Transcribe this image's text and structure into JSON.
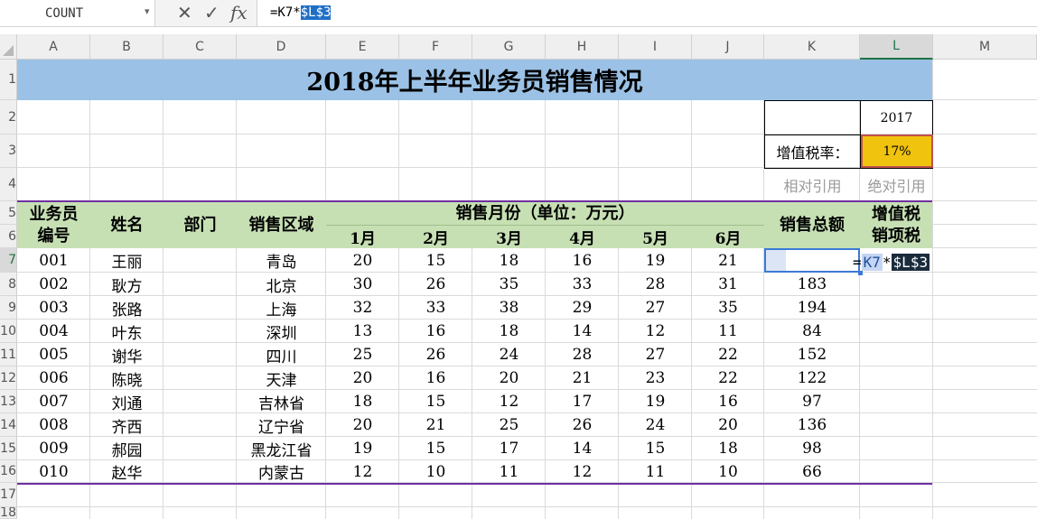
{
  "formula_bar": {
    "name_box": "COUNT",
    "icons": [
      "cancel-icon",
      "enter-icon",
      "function-icon"
    ],
    "cancel_glyph": "✕",
    "enter_glyph": "✓",
    "fx_label": "fx",
    "formula_prefix": "=K7*",
    "formula_abs_ref": "$L$3"
  },
  "columns": [
    "A",
    "B",
    "C",
    "D",
    "E",
    "F",
    "G",
    "H",
    "I",
    "J",
    "K",
    "L",
    "M"
  ],
  "rows": [
    "1",
    "2",
    "3",
    "4",
    "5",
    "6",
    "7",
    "8",
    "9",
    "10",
    "11",
    "12",
    "13",
    "14",
    "15",
    "16",
    "17",
    "18"
  ],
  "title": "2018年上半年业务员销售情况",
  "year_cell": "2017",
  "tax_label": "增值税率：",
  "tax_rate": "17%",
  "relative_ref_label": "相对引用",
  "absolute_ref_label": "绝对引用",
  "headers": {
    "id_line1": "业务员",
    "id_line2": "编号",
    "name": "姓名",
    "dept": "部门",
    "region": "销售区域",
    "months_group": "销售月份（单位：万元）",
    "months": [
      "1月",
      "2月",
      "3月",
      "4月",
      "5月",
      "6月"
    ],
    "total": "销售总额",
    "vat_line1": "增值税",
    "vat_line2": "销项税"
  },
  "editing": {
    "eq": "=",
    "ref1": "K7",
    "op": "*",
    "ref2": "$L$3"
  },
  "data_rows": [
    {
      "id": "001",
      "name": "王丽",
      "dept": "",
      "region": "青岛",
      "m": [
        "20",
        "15",
        "18",
        "16",
        "19",
        "21"
      ],
      "total": "",
      "vat": ""
    },
    {
      "id": "002",
      "name": "耿方",
      "dept": "",
      "region": "北京",
      "m": [
        "30",
        "26",
        "35",
        "33",
        "28",
        "31"
      ],
      "total": "183",
      "vat": ""
    },
    {
      "id": "003",
      "name": "张路",
      "dept": "",
      "region": "上海",
      "m": [
        "32",
        "33",
        "38",
        "29",
        "27",
        "35"
      ],
      "total": "194",
      "vat": ""
    },
    {
      "id": "004",
      "name": "叶东",
      "dept": "",
      "region": "深圳",
      "m": [
        "13",
        "16",
        "18",
        "14",
        "12",
        "11"
      ],
      "total": "84",
      "vat": ""
    },
    {
      "id": "005",
      "name": "谢华",
      "dept": "",
      "region": "四川",
      "m": [
        "25",
        "26",
        "24",
        "28",
        "27",
        "22"
      ],
      "total": "152",
      "vat": ""
    },
    {
      "id": "006",
      "name": "陈晓",
      "dept": "",
      "region": "天津",
      "m": [
        "20",
        "16",
        "20",
        "21",
        "23",
        "22"
      ],
      "total": "122",
      "vat": ""
    },
    {
      "id": "007",
      "name": "刘通",
      "dept": "",
      "region": "吉林省",
      "m": [
        "18",
        "15",
        "12",
        "17",
        "19",
        "16"
      ],
      "total": "97",
      "vat": ""
    },
    {
      "id": "008",
      "name": "齐西",
      "dept": "",
      "region": "辽宁省",
      "m": [
        "20",
        "21",
        "25",
        "26",
        "24",
        "20"
      ],
      "total": "136",
      "vat": ""
    },
    {
      "id": "009",
      "name": "郝园",
      "dept": "",
      "region": "黑龙江省",
      "m": [
        "19",
        "15",
        "17",
        "14",
        "15",
        "18"
      ],
      "total": "98",
      "vat": ""
    },
    {
      "id": "010",
      "name": "赵华",
      "dept": "",
      "region": "内蒙古",
      "m": [
        "12",
        "10",
        "11",
        "12",
        "11",
        "10"
      ],
      "total": "66",
      "vat": ""
    }
  ],
  "colors": {
    "title_fill": "#9bc2e6",
    "header_fill": "#c6e0b4",
    "rate_fill": "#f0c30f",
    "border_purple": "#7030a0",
    "selection_green": "#217346"
  }
}
